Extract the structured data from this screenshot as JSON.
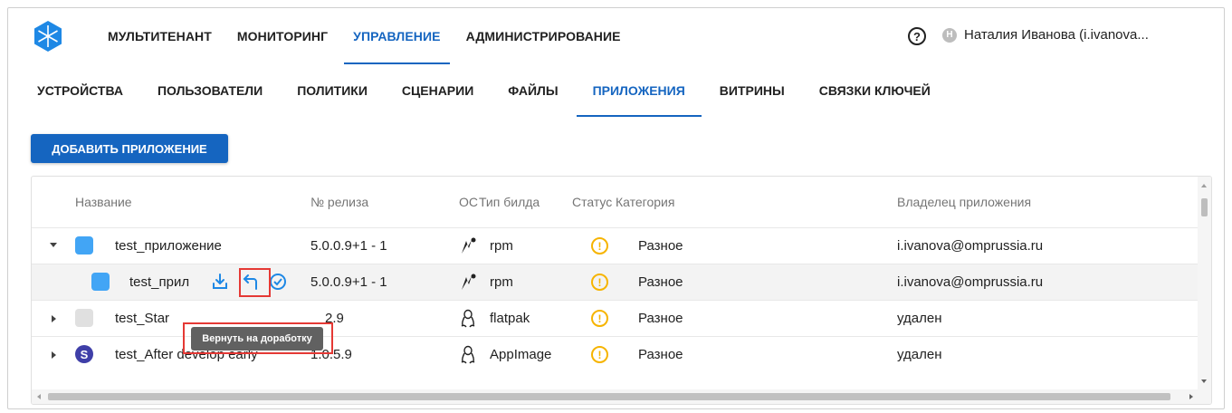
{
  "topnav": {
    "items": [
      "МУЛЬТИТЕНАНТ",
      "МОНИТОРИНГ",
      "УПРАВЛЕНИЕ",
      "АДМИНИСТРИРОВАНИЕ"
    ],
    "active": "УПРАВЛЕНИЕ",
    "help_label": "?",
    "user": {
      "avatar_letter": "Н",
      "name": "Наталия Иванова (i.ivanova..."
    }
  },
  "subnav": {
    "items": [
      "УСТРОЙСТВА",
      "ПОЛЬЗОВАТЕЛИ",
      "ПОЛИТИКИ",
      "СЦЕНАРИИ",
      "ФАЙЛЫ",
      "ПРИЛОЖЕНИЯ",
      "ВИТРИНЫ",
      "СВЯЗКИ КЛЮЧЕЙ"
    ],
    "active": "ПРИЛОЖЕНИЯ"
  },
  "add_button": "ДОБАВИТЬ ПРИЛОЖЕНИЕ",
  "table": {
    "headers": {
      "name": "Название",
      "release": "№ релиза",
      "os": "ОС",
      "build_type": "Тип билда",
      "status": "Статус",
      "category": "Категория",
      "owner": "Владелец приложения"
    },
    "rows": [
      {
        "name": "test_приложение",
        "release": "5.0.0.9+1 - 1",
        "os_icon": "aurora-os-icon",
        "build_type": "rpm",
        "status": "!",
        "category": "Разное",
        "owner": "i.ivanova@omprussia.ru"
      },
      {
        "name": "test_прил",
        "release": "5.0.0.9+1 - 1",
        "os_icon": "aurora-os-icon",
        "build_type": "rpm",
        "status": "!",
        "category": "Разное",
        "owner": "i.ivanova@omprussia.ru"
      },
      {
        "name": "test_Star",
        "release": "2.9",
        "os_icon": "linux-tux-icon",
        "build_type": "flatpak",
        "status": "!",
        "category": "Разное",
        "owner": "удален"
      },
      {
        "name": "test_After develop early",
        "release": "1.0.5.9",
        "os_icon": "linux-tux-icon",
        "build_type": "AppImage",
        "status": "!",
        "category": "Разное",
        "owner": "удален",
        "icon_letter": "S"
      }
    ]
  },
  "tooltip": "Вернуть на доработку",
  "colors": {
    "primary": "#1565c0",
    "warning": "#f6b400",
    "highlight": "#e53935"
  }
}
